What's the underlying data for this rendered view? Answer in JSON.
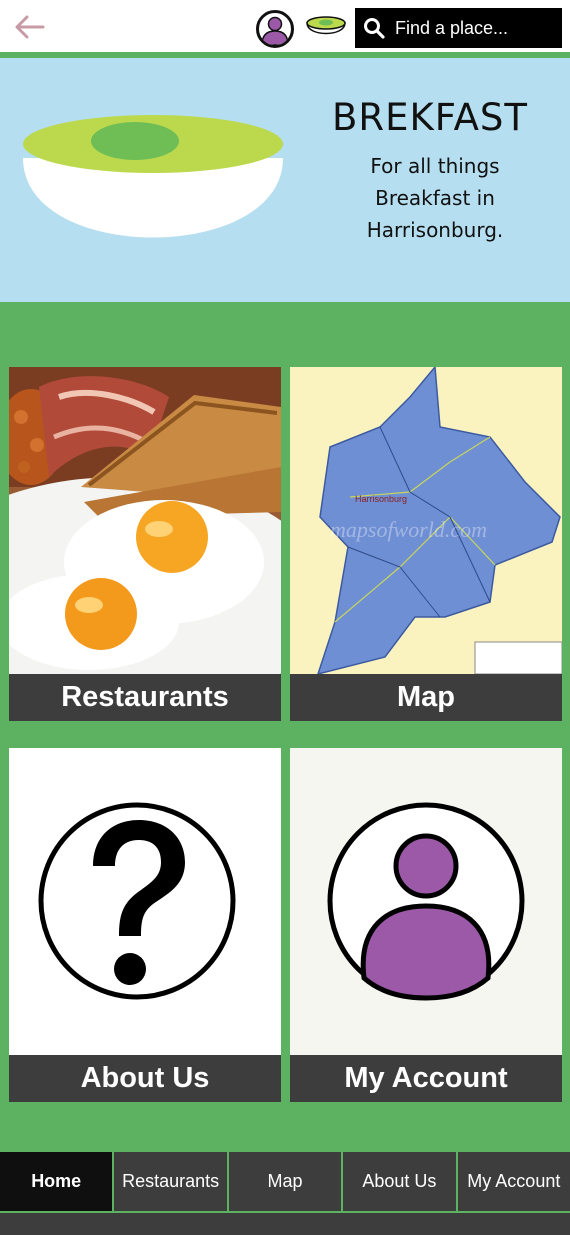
{
  "topbar": {
    "search_placeholder": "Find a place...",
    "icons": [
      "back-arrow-icon",
      "user-avatar-icon",
      "bowl-logo-icon",
      "search-icon"
    ]
  },
  "hero": {
    "title": "BREKFAST",
    "subtitle_lines": [
      "For all things",
      "Breakfast in",
      "Harrisonburg."
    ]
  },
  "cards": [
    {
      "label": "Restaurants",
      "image": "breakfast-plate-photo"
    },
    {
      "label": "Map",
      "image": "harrisonburg-map"
    },
    {
      "label": "About Us",
      "image": "question-mark-icon"
    },
    {
      "label": "My Account",
      "image": "user-account-icon"
    }
  ],
  "map_image_labels": {
    "city": "Harrisonburg",
    "watermark": "mapsofworld.com"
  },
  "bottom_nav": [
    {
      "label": "Home",
      "active": true
    },
    {
      "label": "Restaurants",
      "active": false
    },
    {
      "label": "Map",
      "active": false
    },
    {
      "label": "About Us",
      "active": false
    },
    {
      "label": "My Account",
      "active": false
    }
  ],
  "colors": {
    "green": "#5cb260",
    "hero_bg": "#b5def0",
    "label_bg": "#3e3d3e",
    "avatar_purple": "#9b59a8",
    "bowl_lime": "#bcd94e",
    "bowl_center": "#6ebd55"
  }
}
